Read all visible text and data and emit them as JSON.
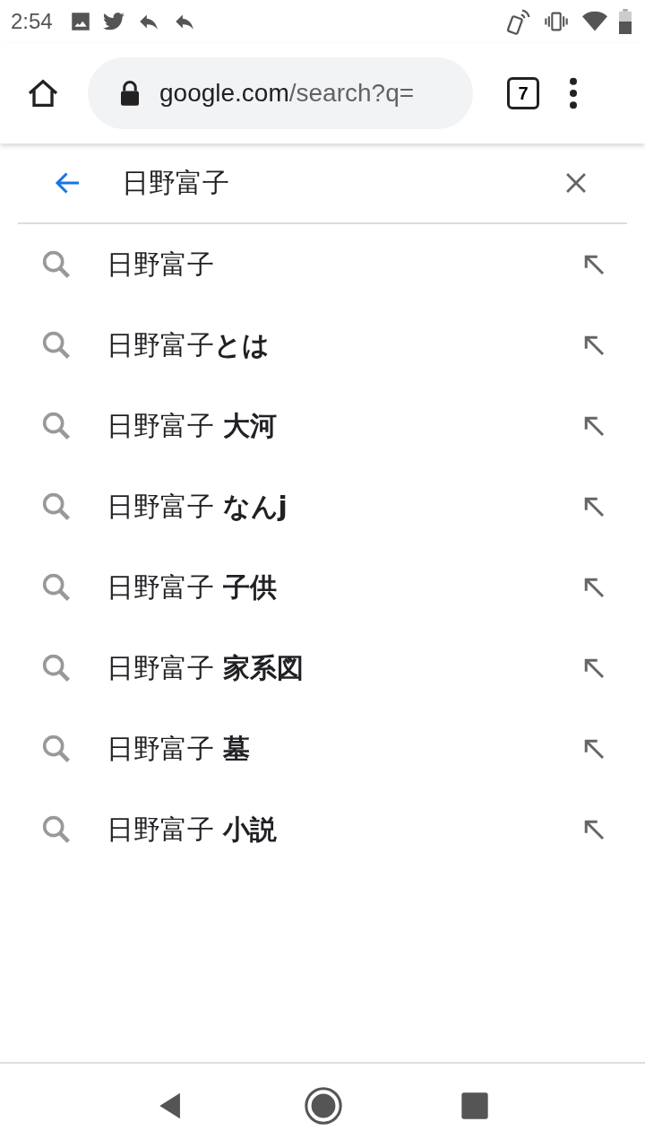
{
  "status_bar": {
    "time": "2:54"
  },
  "toolbar": {
    "url_host": "google.com",
    "url_path": "/search?q=",
    "tab_count": "7"
  },
  "search": {
    "value": "日野富子"
  },
  "suggestions": [
    {
      "text": "日野富子"
    },
    {
      "text": "日野富子**とは**"
    },
    {
      "text": "日野富子 **大河**"
    },
    {
      "text": "日野富子 **なんj**"
    },
    {
      "text": "日野富子 **子供**"
    },
    {
      "text": "日野富子 **家系図**"
    },
    {
      "text": "日野富子 **墓**"
    },
    {
      "text": "日野富子 **小説**"
    }
  ]
}
